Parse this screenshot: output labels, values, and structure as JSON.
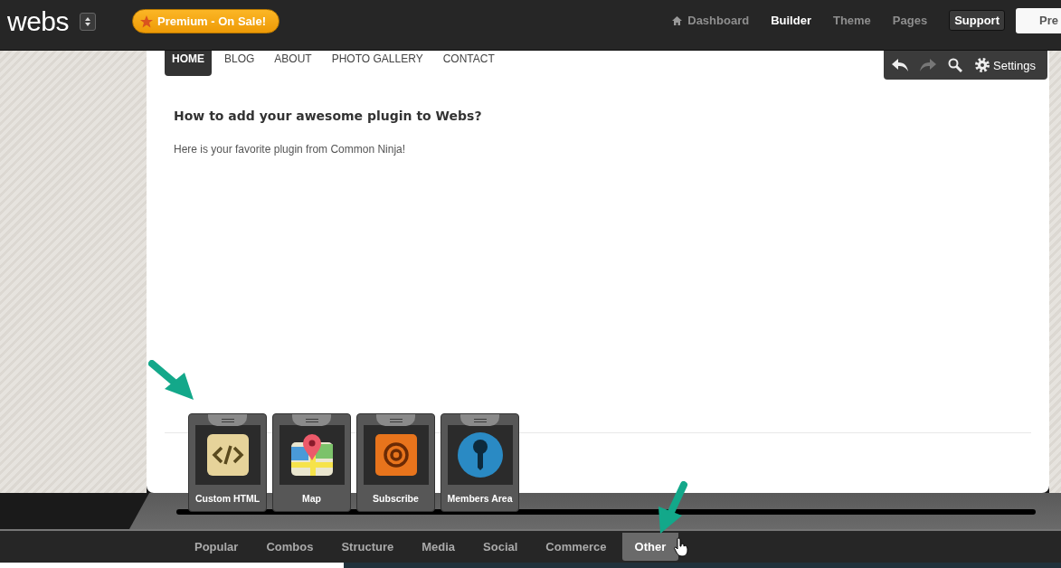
{
  "header": {
    "logo": "webs",
    "premium_button": "Premium - On Sale!",
    "nav": [
      {
        "label": "Dashboard",
        "selected": false,
        "kind": "home"
      },
      {
        "label": "Builder",
        "selected": true,
        "kind": "link"
      },
      {
        "label": "Theme",
        "selected": false,
        "kind": "link"
      },
      {
        "label": "Pages",
        "selected": false,
        "kind": "link"
      },
      {
        "label": "Support",
        "selected": false,
        "kind": "boxed"
      }
    ],
    "preview_button": "Pre"
  },
  "site_nav": [
    {
      "label": "HOME",
      "selected": true
    },
    {
      "label": "BLOG",
      "selected": false
    },
    {
      "label": "ABOUT",
      "selected": false
    },
    {
      "label": "PHOTO GALLERY",
      "selected": false
    },
    {
      "label": "CONTACT",
      "selected": false
    }
  ],
  "toolbar": {
    "settings": "Settings"
  },
  "page": {
    "heading": "How to add your awesome plugin to Webs?",
    "paragraph": "Here is your favorite plugin from Common Ninja!"
  },
  "widgets": [
    {
      "label": "Custom HTML",
      "kind": "html"
    },
    {
      "label": "Map",
      "kind": "map"
    },
    {
      "label": "Subscribe",
      "kind": "subscribe"
    },
    {
      "label": "Members Area",
      "kind": "members"
    }
  ],
  "categories": [
    {
      "label": "Popular",
      "selected": false
    },
    {
      "label": "Combos",
      "selected": false
    },
    {
      "label": "Structure",
      "selected": false
    },
    {
      "label": "Media",
      "selected": false
    },
    {
      "label": "Social",
      "selected": false
    },
    {
      "label": "Commerce",
      "selected": false
    },
    {
      "label": "Other",
      "selected": true
    }
  ]
}
